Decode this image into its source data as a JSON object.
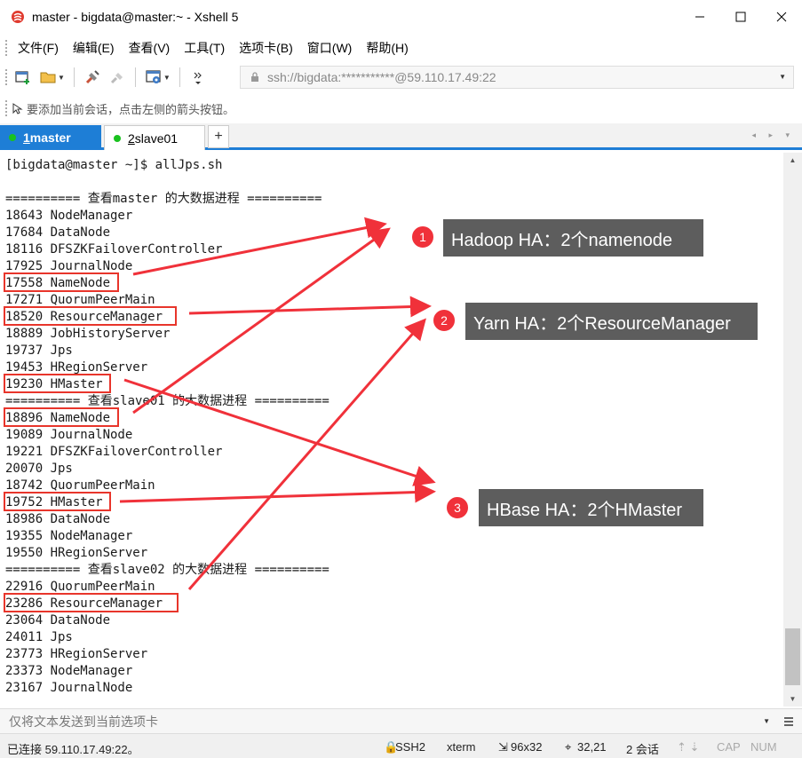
{
  "window": {
    "title": "master - bigdata@master:~ - Xshell 5",
    "minimize": "—",
    "maximize": "☐",
    "close": "✕"
  },
  "menu": [
    "文件(F)",
    "编辑(E)",
    "查看(V)",
    "工具(T)",
    "选项卡(B)",
    "窗口(W)",
    "帮助(H)"
  ],
  "address": {
    "value": "ssh://bigdata:***********@59.110.17.49:22"
  },
  "hint": "要添加当前会话，点击左侧的箭头按钮。",
  "tabs": {
    "active": {
      "num": "1",
      "label": " master"
    },
    "second": {
      "num": "2",
      "label": " slave01"
    },
    "add": "+",
    "nav": "◂ ▸ ▾"
  },
  "terminal": {
    "lines": [
      "[bigdata@master ~]$ allJps.sh",
      "",
      "========== 查看master 的大数据进程 ==========",
      "18643 NodeManager",
      "17684 DataNode",
      "18116 DFSZKFailoverController",
      "17925 JournalNode",
      "17558 NameNode",
      "17271 QuorumPeerMain",
      "18520 ResourceManager",
      "18889 JobHistoryServer",
      "19737 Jps",
      "19453 HRegionServer",
      "19230 HMaster",
      "========== 查看slave01 的大数据进程 ==========",
      "18896 NameNode",
      "19089 JournalNode",
      "19221 DFSZKFailoverController",
      "20070 Jps",
      "18742 QuorumPeerMain",
      "19752 HMaster",
      "18986 DataNode",
      "19355 NodeManager",
      "19550 HRegionServer",
      "========== 查看slave02 的大数据进程 ==========",
      "22916 QuorumPeerMain",
      "23286 ResourceManager",
      "23064 DataNode",
      "24011 Jps",
      "23773 HRegionServer",
      "23373 NodeManager",
      "23167 JournalNode"
    ]
  },
  "annotations": {
    "callout1": {
      "badge": "1",
      "text": "Hadoop HA：2个namenode"
    },
    "callout2": {
      "badge": "2",
      "text": "Yarn HA：2个ResourceManager"
    },
    "callout3": {
      "badge": "3",
      "text": "HBase HA：2个HMaster"
    },
    "accent": "#f0313a"
  },
  "inputbar": {
    "placeholder": "仅将文本发送到当前选项卡"
  },
  "status": {
    "connection": "已连接 59.110.17.49:22。",
    "protocol": "SSH2",
    "terminal_type": "xterm",
    "size": "96x32",
    "cursor": "32,21",
    "sessions": "2 会话",
    "caps": "CAP",
    "num": "NUM"
  }
}
